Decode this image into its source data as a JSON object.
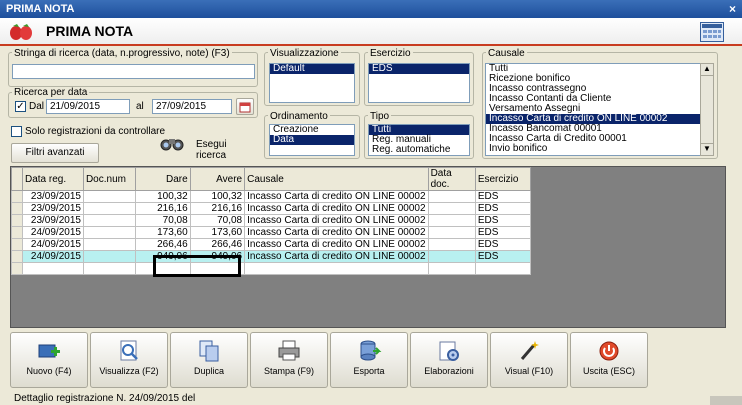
{
  "window": {
    "title": "PRIMA NOTA",
    "close": "×"
  },
  "header": {
    "title": "PRIMA NOTA"
  },
  "search": {
    "label": "Stringa di ricerca (data, n.progressivo, note) (F3)",
    "value": ""
  },
  "date_search": {
    "label": "Ricerca per data",
    "dal_label": "Dal",
    "dal_checked": true,
    "dal_value": "21/09/2015",
    "al_label": "al",
    "al_value": "27/09/2015"
  },
  "solo_label": "Solo registrazioni da controllare",
  "filtri_button": "Filtri avanzati",
  "esegui_button": "Esegui ricerca",
  "visualizzazione": {
    "label": "Visualizzazione",
    "items": [
      "Default"
    ],
    "selected": 0
  },
  "esercizio": {
    "label": "Esercizio",
    "items": [
      "EDS"
    ],
    "selected": 0
  },
  "ordinamento": {
    "label": "Ordinamento",
    "items": [
      "Creazione",
      "Data"
    ],
    "selected": 1
  },
  "tipo": {
    "label": "Tipo",
    "items": [
      "Tutti",
      "Reg. manuali",
      "Reg. automatiche"
    ],
    "selected": 0
  },
  "causale": {
    "label": "Causale",
    "items": [
      "Tutti",
      "Ricezione bonifico",
      "Incasso contrassegno",
      "Incasso Contanti da Cliente",
      "Versamento Assegni",
      "Incasso Carta di credito ON LINE 00002",
      "Incasso Bancomat 00001",
      "Incasso Carta di Credito 00001",
      "Invio bonifico"
    ],
    "selected": 5
  },
  "table": {
    "columns": [
      "Data reg.",
      "Doc.num",
      "Dare",
      "Avere",
      "Causale",
      "Data doc.",
      "Esercizio"
    ],
    "rows": [
      [
        "23/09/2015",
        "",
        "100,32",
        "100,32",
        "Incasso Carta di credito ON LINE 00002",
        "",
        "EDS"
      ],
      [
        "23/09/2015",
        "",
        "216,16",
        "216,16",
        "Incasso Carta di credito ON LINE 00002",
        "",
        "EDS"
      ],
      [
        "23/09/2015",
        "",
        "70,08",
        "70,08",
        "Incasso Carta di credito ON LINE 00002",
        "",
        "EDS"
      ],
      [
        "24/09/2015",
        "",
        "173,60",
        "173,60",
        "Incasso Carta di credito ON LINE 00002",
        "",
        "EDS"
      ],
      [
        "24/09/2015",
        "",
        "266,46",
        "266,46",
        "Incasso Carta di credito ON LINE 00002",
        "",
        "EDS"
      ],
      [
        "24/09/2015",
        "",
        "949,06",
        "949,06",
        "Incasso Carta di credito ON LINE 00002",
        "",
        "EDS"
      ]
    ],
    "highlighted_row": 5
  },
  "toolbar": [
    {
      "label": "Nuovo (F4)",
      "icon": "add-icon"
    },
    {
      "label": "Visualizza (F2)",
      "icon": "view-icon"
    },
    {
      "label": "Duplica",
      "icon": "duplicate-icon"
    },
    {
      "label": "Stampa (F9)",
      "icon": "print-icon"
    },
    {
      "label": "Esporta",
      "icon": "export-icon"
    },
    {
      "label": "Elaborazioni",
      "icon": "process-icon"
    },
    {
      "label": "Visual (F10)",
      "icon": "wand-icon"
    },
    {
      "label": "Uscita (ESC)",
      "icon": "exit-icon"
    }
  ],
  "footer": {
    "text": "Dettaglio registrazione N. 24/09/2015 del"
  },
  "colors": {
    "selection": "#0a246a",
    "highlight_row": "#b8f0f0",
    "header_accent": "#c83c20",
    "titlebar": "#2a5ea9"
  }
}
